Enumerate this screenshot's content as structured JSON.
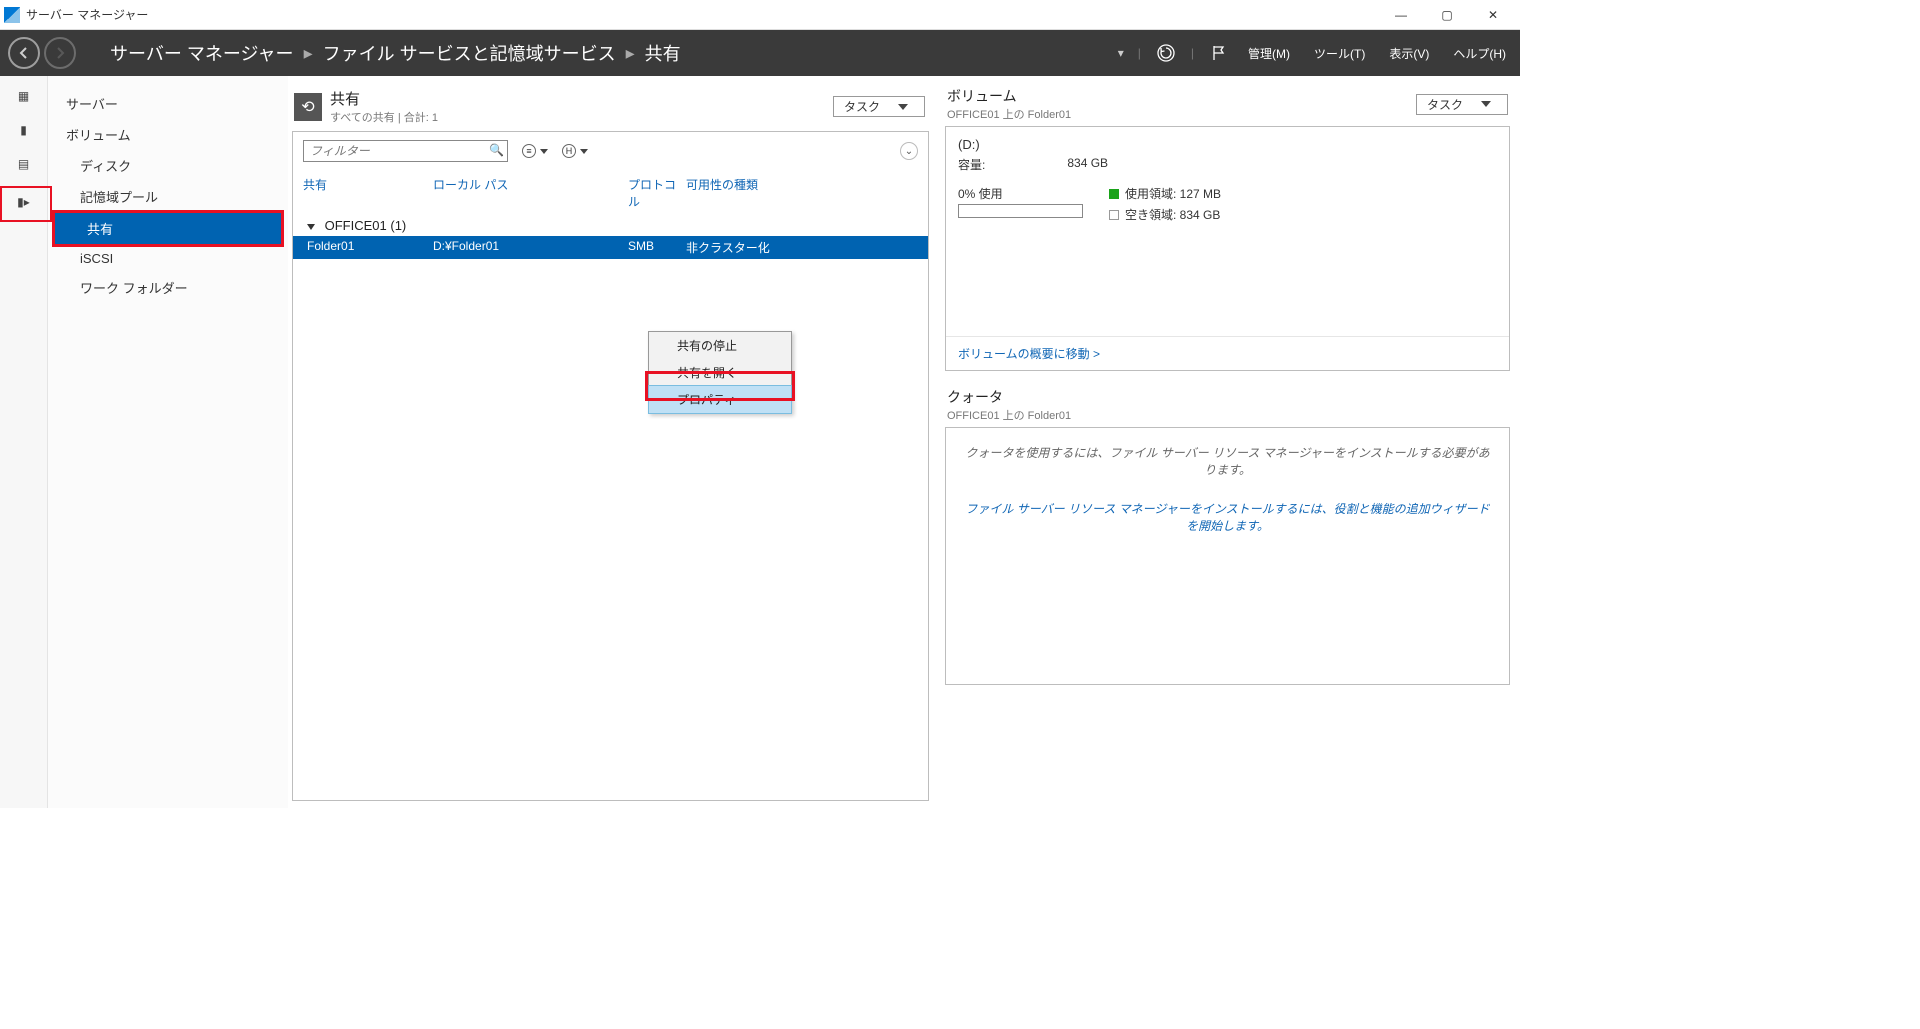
{
  "window": {
    "title": "サーバー マネージャー"
  },
  "header": {
    "breadcrumb": [
      "サーバー マネージャー",
      "ファイル サービスと記憶域サービス",
      "共有"
    ],
    "menus": {
      "manage": "管理(M)",
      "tools": "ツール(T)",
      "view": "表示(V)",
      "help": "ヘルプ(H)"
    }
  },
  "sidebar": {
    "items": [
      {
        "label": "サーバー",
        "indent": 0
      },
      {
        "label": "ボリューム",
        "indent": 0
      },
      {
        "label": "ディスク",
        "indent": 1
      },
      {
        "label": "記憶域プール",
        "indent": 1
      },
      {
        "label": "共有",
        "indent": 1,
        "selected": true
      },
      {
        "label": "iSCSI",
        "indent": 1
      },
      {
        "label": "ワーク フォルダー",
        "indent": 1
      }
    ]
  },
  "shares_panel": {
    "title": "共有",
    "subtitle": "すべての共有 | 合計: 1",
    "task_label": "タスク",
    "filter_placeholder": "フィルター",
    "columns": {
      "share": "共有",
      "path": "ローカル パス",
      "protocol": "プロトコル",
      "availability": "可用性の種類"
    },
    "group": "OFFICE01 (1)",
    "row": {
      "share": "Folder01",
      "path": "D:¥Folder01",
      "protocol": "SMB",
      "availability": "非クラスター化"
    }
  },
  "context_menu": {
    "items": [
      {
        "label": "共有の停止"
      },
      {
        "label": "共有を開く"
      },
      {
        "label": "プロパティ",
        "hover": true
      }
    ]
  },
  "volume_panel": {
    "title": "ボリューム",
    "subtitle": "OFFICE01 上の Folder01",
    "task_label": "タスク",
    "drive": "(D:)",
    "capacity_label": "容量:",
    "capacity_value": "834 GB",
    "usage_label": "0% 使用",
    "used_label": "使用領域: 127 MB",
    "free_label": "空き領域: 834 GB",
    "link": "ボリュームの概要に移動 >"
  },
  "quota_panel": {
    "title": "クォータ",
    "subtitle": "OFFICE01 上の Folder01",
    "message": "クォータを使用するには、ファイル サーバー リソース マネージャーをインストールする必要があります。",
    "link": "ファイル サーバー リソース マネージャーをインストールするには、役割と機能の追加ウィザードを開始します。"
  }
}
